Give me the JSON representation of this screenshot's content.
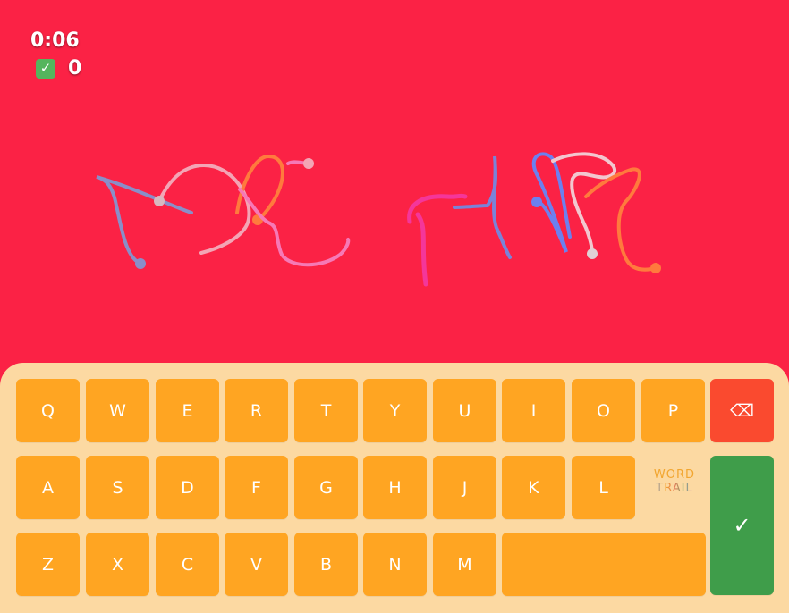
{
  "hud": {
    "timer": "0:06",
    "score": "0",
    "score_icon": "check-icon"
  },
  "keyboard": {
    "row1": [
      "Q",
      "W",
      "E",
      "R",
      "T",
      "Y",
      "U",
      "I",
      "O",
      "P"
    ],
    "row2": [
      "A",
      "S",
      "D",
      "F",
      "G",
      "H",
      "J",
      "K",
      "L"
    ],
    "row3": [
      "Z",
      "X",
      "C",
      "V",
      "B",
      "N",
      "M"
    ],
    "backspace_label": "⌫",
    "enter_label": "✓",
    "space_label": ""
  },
  "logo": {
    "line1": "WORD",
    "line2": "TRAIL"
  },
  "colors": {
    "background": "#fb2245",
    "key": "#ffa522",
    "keyboard_panel": "#fcd9a2",
    "backspace": "#fa4a2f",
    "enter": "#3f9d4a"
  }
}
